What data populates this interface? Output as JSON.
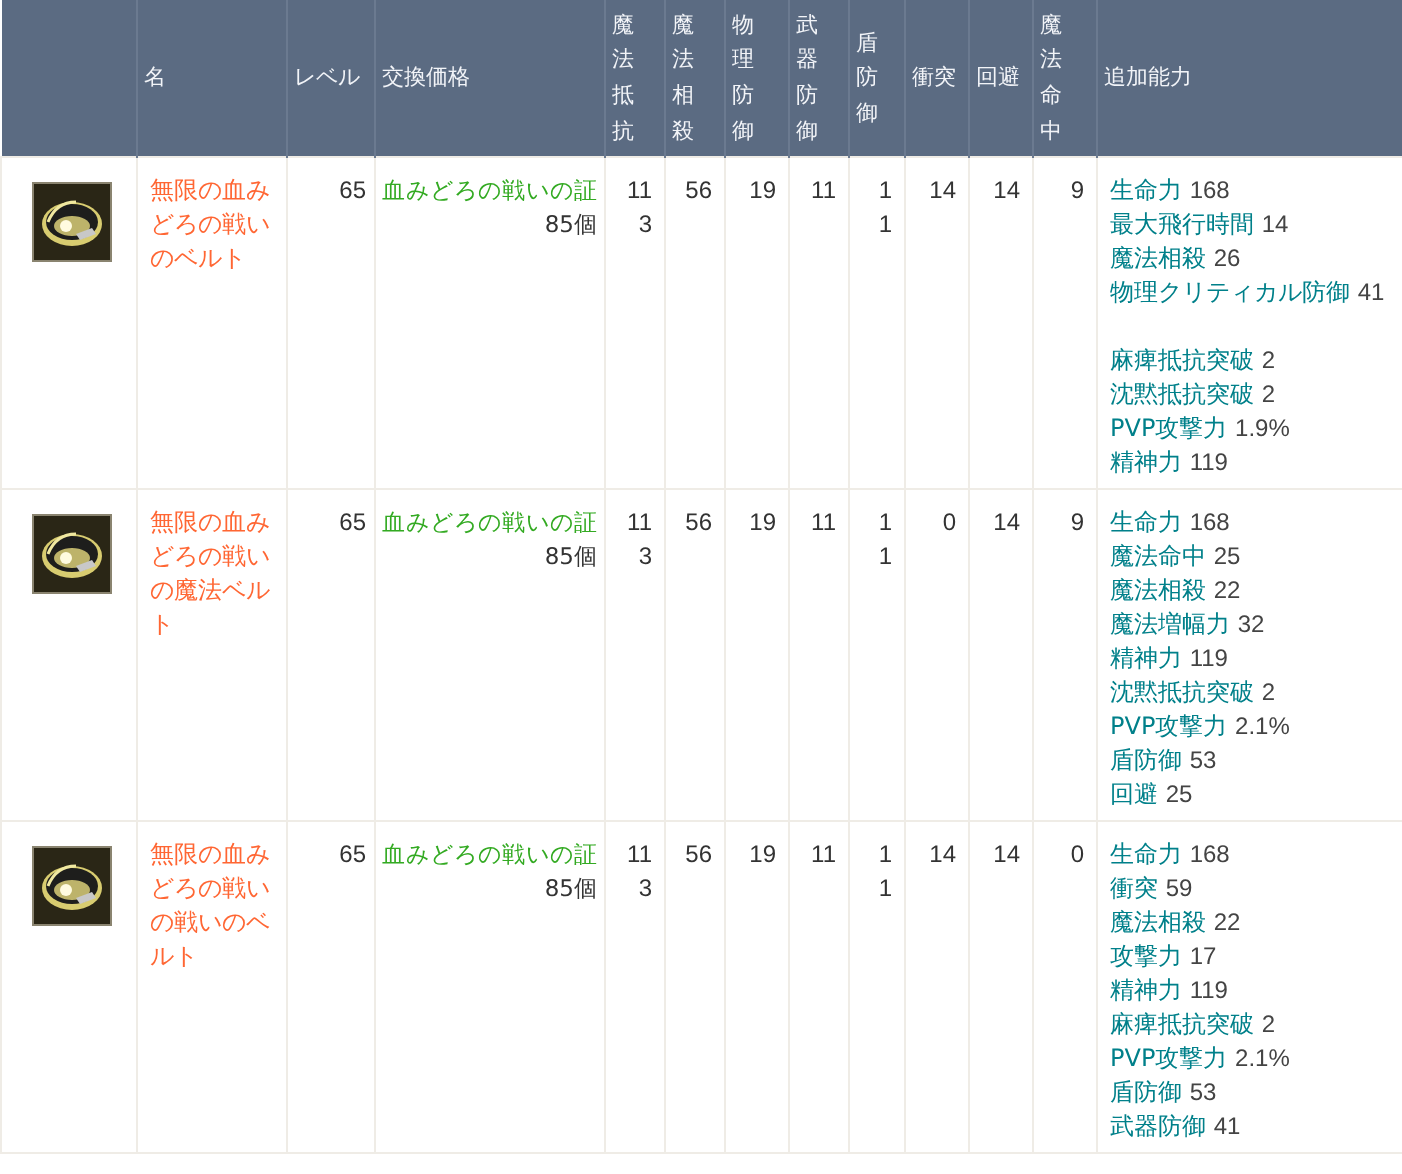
{
  "table": {
    "columns": [
      "名",
      "レベル",
      "交換価格",
      "魔法抵抗",
      "魔法相殺",
      "物理防御",
      "武器防御",
      "盾防御",
      "衝突",
      "回避",
      "魔法命中",
      "追加能力"
    ],
    "rows": [
      {
        "name": "無限の血みどろの戦いのベルト",
        "level": "65",
        "price": {
          "item": "血みどろの戦いの証",
          "count": "85個"
        },
        "stats": [
          "113",
          "56",
          "19",
          "11",
          "11",
          "14",
          "14",
          "9"
        ],
        "bonuses": [
          {
            "kind": "stat",
            "name": "生命力",
            "value": "168"
          },
          {
            "kind": "stat",
            "name": "最大飛行時間",
            "value": "14"
          },
          {
            "kind": "stat",
            "name": "魔法相殺",
            "value": "26"
          },
          {
            "kind": "stat",
            "name": "物理クリティカル防御",
            "value": "41"
          },
          {
            "kind": "spacer"
          },
          {
            "kind": "stat",
            "name": "麻痺抵抗突破",
            "value": "2"
          },
          {
            "kind": "stat",
            "name": "沈黙抵抗突破",
            "value": "2"
          },
          {
            "kind": "stat",
            "name": "PVP攻撃力",
            "value": "1.9%"
          },
          {
            "kind": "stat",
            "name": "精神力",
            "value": "119"
          }
        ]
      },
      {
        "name": "無限の血みどろの戦いの魔法ベルト",
        "level": "65",
        "price": {
          "item": "血みどろの戦いの証",
          "count": "85個"
        },
        "stats": [
          "113",
          "56",
          "19",
          "11",
          "11",
          "0",
          "14",
          "9"
        ],
        "bonuses": [
          {
            "kind": "stat",
            "name": "生命力",
            "value": "168"
          },
          {
            "kind": "stat",
            "name": "魔法命中",
            "value": "25"
          },
          {
            "kind": "stat",
            "name": "魔法相殺",
            "value": "22"
          },
          {
            "kind": "stat",
            "name": "魔法増幅力",
            "value": "32"
          },
          {
            "kind": "stat",
            "name": "精神力",
            "value": "119"
          },
          {
            "kind": "stat",
            "name": "沈黙抵抗突破",
            "value": "2"
          },
          {
            "kind": "stat",
            "name": "PVP攻撃力",
            "value": "2.1%"
          },
          {
            "kind": "stat",
            "name": "盾防御",
            "value": "53"
          },
          {
            "kind": "stat",
            "name": "回避",
            "value": "25"
          }
        ]
      },
      {
        "name": "無限の血みどろの戦いの戦いのベルト",
        "level": "65",
        "price": {
          "item": "血みどろの戦いの証",
          "count": "85個"
        },
        "stats": [
          "113",
          "56",
          "19",
          "11",
          "11",
          "14",
          "14",
          "0"
        ],
        "bonuses": [
          {
            "kind": "stat",
            "name": "生命力",
            "value": "168"
          },
          {
            "kind": "stat",
            "name": "衝突",
            "value": "59"
          },
          {
            "kind": "stat",
            "name": "魔法相殺",
            "value": "22"
          },
          {
            "kind": "stat",
            "name": "攻撃力",
            "value": "17"
          },
          {
            "kind": "stat",
            "name": "精神力",
            "value": "119"
          },
          {
            "kind": "stat",
            "name": "麻痺抵抗突破",
            "value": "2"
          },
          {
            "kind": "stat",
            "name": "PVP攻撃力",
            "value": "2.1%"
          },
          {
            "kind": "stat",
            "name": "盾防御",
            "value": "53"
          },
          {
            "kind": "stat",
            "name": "武器防御",
            "value": "41"
          }
        ]
      }
    ]
  }
}
